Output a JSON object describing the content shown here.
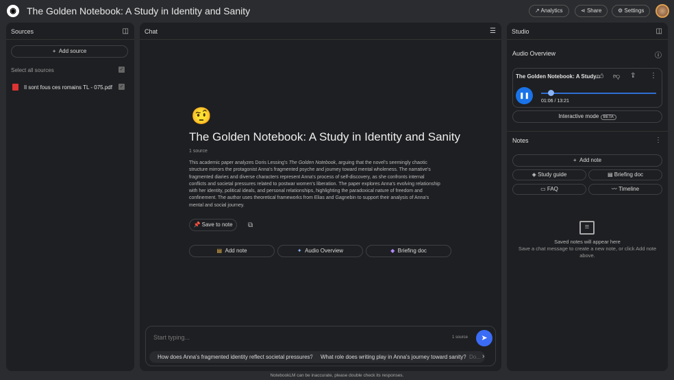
{
  "header": {
    "title": "The Golden Notebook:  A Study in Identity and Sanity",
    "analytics": "Analytics",
    "share": "Share",
    "settings": "Settings"
  },
  "sources": {
    "title": "Sources",
    "add_source": "Add source",
    "select_all": "Select all sources",
    "items": [
      {
        "name": "Il sont fous ces romains TL - 075.pdf"
      }
    ]
  },
  "chat": {
    "title": "Chat",
    "emoji": "🤨",
    "notebook_title": "The Golden Notebook: A Study in Identity and Sanity",
    "source_count": "1 source",
    "summary_pre": "This academic paper analyzes Doris Lessing's ",
    "summary_book": "The Golden Notebook",
    "summary_post": ", arguing that the novel's seemingly chaotic structure mirrors the protagonist Anna's fragmented psyche and journey toward mental wholeness. The narrative's fragmented diaries and diverse characters represent Anna's process of self-discovery, as she confronts internal conflicts and societal pressures related to postwar women's liberation. The paper explores Anna's evolving relationship with her identity, political ideals, and personal relationships, highlighting the paradoxical nature of freedom and confinement. The author uses theoretical frameworks from Elias and Gagnebin to support their analysis of Anna's mental and social journey.",
    "save_to_note": "Save to note",
    "add_note": "Add note",
    "audio_overview": "Audio Overview",
    "briefing_doc": "Briefing doc",
    "input_placeholder": "Start typing...",
    "input_source_count": "1 source",
    "suggestions": [
      "How does Anna's fragmented identity reflect societal pressures?",
      "What role does writing play in Anna's journey toward sanity?",
      "Do..."
    ]
  },
  "studio": {
    "title": "Studio",
    "audio_overview": "Audio Overview",
    "audio_title": "The Golden Notebook: A Study...",
    "time": "01:06 / 13:21",
    "progress": 0.083,
    "interactive_mode": "Interactive mode",
    "beta": "BETA",
    "notes_title": "Notes",
    "add_note": "Add note",
    "study_guide": "Study guide",
    "briefing_doc": "Briefing doc",
    "faq": "FAQ",
    "timeline": "Timeline",
    "empty_title": "Saved notes will appear here",
    "empty_desc": "Save a chat message to create a new note, or click Add note above."
  },
  "footer": "NotebookLM can be inaccurate, please double check its responses.",
  "colors": {
    "accent": "#4285f4",
    "send": "#3b6cf5"
  }
}
